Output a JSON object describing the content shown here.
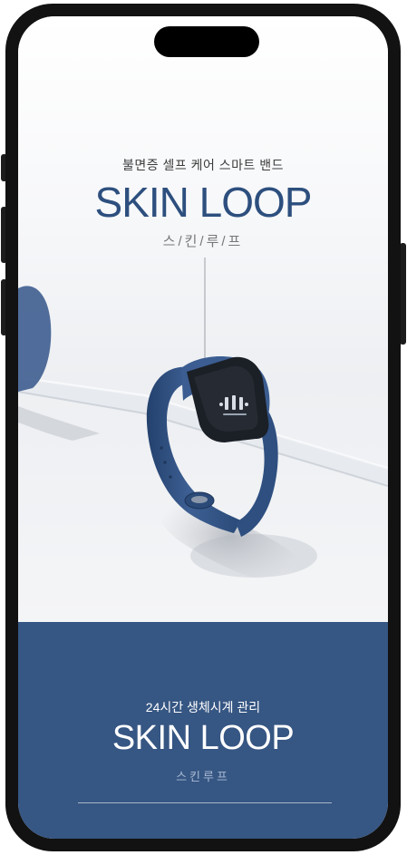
{
  "hero": {
    "tagline": "불면증 셀프 케어 스마트 밴드",
    "title": "SKIN LOOP",
    "subtitle": "스/킨/루/프",
    "product_image": "blue-smart-band-photo"
  },
  "panel": {
    "tagline": "24시간 생체시계 관리",
    "title": "SKIN LOOP",
    "subtitle": "스킨루프"
  },
  "colors": {
    "brand_blue": "#2d4f7e",
    "panel_blue": "#365683",
    "band_blue": "#3a5c8f",
    "phone_frame": "#121212"
  }
}
